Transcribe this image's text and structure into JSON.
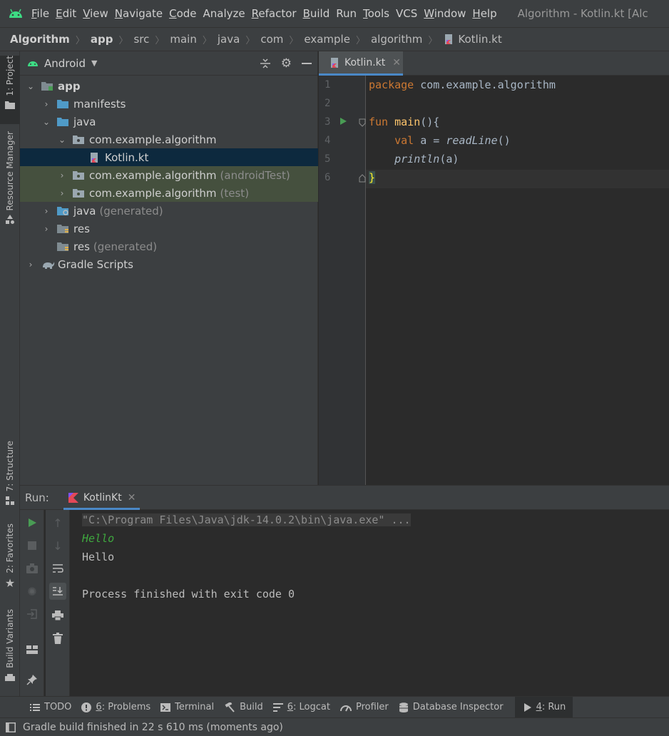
{
  "menu": {
    "items": [
      {
        "mnemonic": "F",
        "rest": "ile"
      },
      {
        "mnemonic": "E",
        "rest": "dit"
      },
      {
        "mnemonic": "V",
        "rest": "iew"
      },
      {
        "mnemonic": "N",
        "rest": "avigate"
      },
      {
        "mnemonic": "C",
        "rest": "ode"
      },
      {
        "mnemonic": "",
        "rest": "Analyze"
      },
      {
        "mnemonic": "R",
        "rest": "efactor"
      },
      {
        "mnemonic": "B",
        "rest": "uild"
      },
      {
        "mnemonic": "",
        "rest": "Run"
      },
      {
        "mnemonic": "T",
        "rest": "ools"
      },
      {
        "mnemonic": "",
        "rest": "VCS"
      },
      {
        "mnemonic": "W",
        "rest": "indow"
      },
      {
        "mnemonic": "H",
        "rest": "elp"
      }
    ],
    "window_title": "Algorithm - Kotlin.kt [Alc"
  },
  "breadcrumb": [
    "Algorithm",
    "app",
    "src",
    "main",
    "java",
    "com",
    "example",
    "algorithm",
    "Kotlin.kt"
  ],
  "left_strip": {
    "project": "1: Project",
    "resource_manager": "Resource Manager",
    "structure": "7: Structure",
    "favorites": "2: Favorites",
    "build_variants": "Build Variants"
  },
  "project_panel": {
    "view": "Android",
    "tree": [
      {
        "label": "app",
        "suffix": ""
      },
      {
        "label": "manifests",
        "suffix": ""
      },
      {
        "label": "java",
        "suffix": ""
      },
      {
        "label": "com.example.algorithm",
        "suffix": ""
      },
      {
        "label": "Kotlin.kt",
        "suffix": ""
      },
      {
        "label": "com.example.algorithm",
        "suffix": "(androidTest)"
      },
      {
        "label": "com.example.algorithm",
        "suffix": "(test)"
      },
      {
        "label": "java",
        "suffix": "(generated)"
      },
      {
        "label": "res",
        "suffix": ""
      },
      {
        "label": "res",
        "suffix": "(generated)"
      },
      {
        "label": "Gradle Scripts",
        "suffix": ""
      }
    ]
  },
  "editor": {
    "tab": "Kotlin.kt",
    "line_numbers": [
      "1",
      "2",
      "3",
      "4",
      "5",
      "6"
    ],
    "code": {
      "l1_kw": "package",
      "l1_rest": " com.example.algorithm",
      "l3_kw": "fun",
      "l3_fn": "main",
      "l3_rest": "(){",
      "l4_kw": "val",
      "l4_mid": " a = ",
      "l4_call": "readLine",
      "l4_end": "()",
      "l5_call": "println",
      "l5_end": "(a)",
      "l6": "}"
    }
  },
  "run_panel": {
    "label": "Run:",
    "tab": "KotlinKt",
    "console": [
      "\"C:\\Program Files\\Java\\jdk-14.0.2\\bin\\java.exe\" ...",
      "Hello",
      "Hello",
      "",
      "Process finished with exit code 0"
    ]
  },
  "bottom_bar": [
    {
      "prefix": "",
      "label": "TODO"
    },
    {
      "prefix": "6",
      "label": ": Problems"
    },
    {
      "prefix": "",
      "label": "Terminal"
    },
    {
      "prefix": "",
      "label": "Build"
    },
    {
      "prefix": "6",
      "label": ": Logcat"
    },
    {
      "prefix": "",
      "label": "Profiler"
    },
    {
      "prefix": "",
      "label": "Database Inspector"
    },
    {
      "prefix": "4",
      "label": ": Run"
    }
  ],
  "status": "Gradle build finished in 22 s 610 ms (moments ago)",
  "colors": {
    "keyword": "#cc7832",
    "function": "#ffc66d",
    "accent": "#4a88c7",
    "selection": "#0d293e",
    "test_tint": "#45503e",
    "android_green": "#3ddc84",
    "run_green": "#499c54",
    "input_green": "#3fa83f"
  }
}
